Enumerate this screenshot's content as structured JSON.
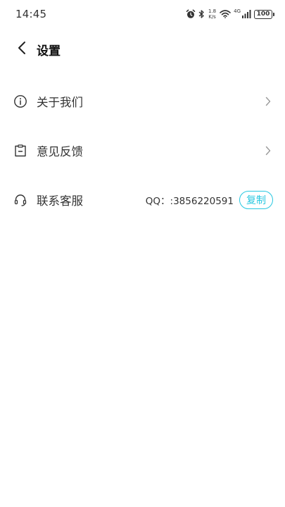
{
  "status_bar": {
    "time": "14:45",
    "net_speed_value": "1.8",
    "net_speed_unit": "K/s",
    "network_type": "4G",
    "battery": "100",
    "icons": [
      "alarm-icon",
      "bluetooth-icon",
      "wifi-icon",
      "cellular-signal-icon",
      "battery-icon"
    ]
  },
  "header": {
    "title": "设置",
    "back_icon": "chevron-left-icon"
  },
  "menu": {
    "items": [
      {
        "label": "关于我们",
        "icon": "info-circle-icon",
        "trailing": "chevron-right-icon"
      },
      {
        "label": "意见反馈",
        "icon": "feedback-clipboard-icon",
        "trailing": "chevron-right-icon"
      },
      {
        "label": "联系客服",
        "icon": "headset-icon",
        "qq_label": "QQ：:3856220591",
        "copy_label": "复制"
      }
    ]
  },
  "colors": {
    "accent": "#27c7e0",
    "text": "#333333",
    "title": "#111111",
    "chevron": "#999999",
    "background": "#ffffff"
  }
}
